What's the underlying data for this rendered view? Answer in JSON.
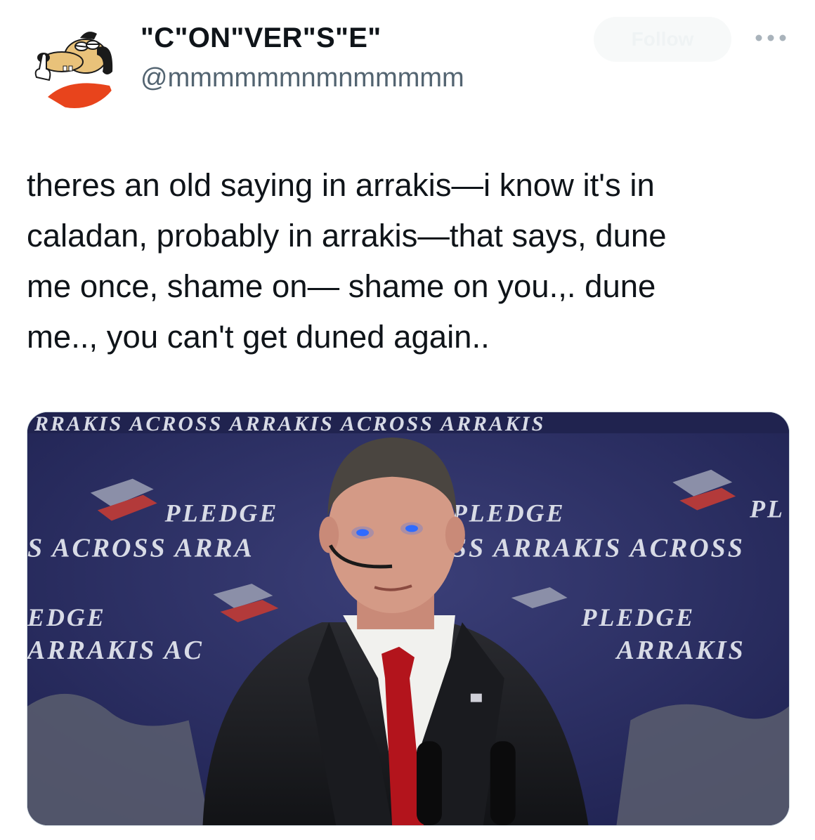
{
  "tweet": {
    "author": {
      "display_name": "\"C\"ON\"VER\"S\"E\"",
      "handle": "@mmmmmmnmnmmmmm",
      "avatar_icon": "cartoon-dog-avatar"
    },
    "follow_label": "Follow",
    "more_icon": "more-dots-icon",
    "text_lines": [
      "theres an old saying in arrakis—i know it's in",
      "caladan, probably in arrakis—that says, dune",
      "me once, shame on— shame on you.,. dune",
      "me.., you can't get duned again.."
    ],
    "media": {
      "backdrop_text": {
        "top_strip": "RRAKIS  ACROSS ARRAKIS  ACROSS ARRAKIS",
        "pledge": "PLEDGE",
        "across_arrakis_1": "S  ACROSS ARRA",
        "across_arrakis_2": "SS ARRAKIS  ACROSS",
        "edge": "EDGE",
        "arrakis_left": "ARRAKIS  AC",
        "arrakis_right": "ARRAKIS",
        "pl": "PL",
        "pledge_partial": "PLEDGE"
      }
    },
    "colors": {
      "text": "#0f1419",
      "secondary": "#536471",
      "backdrop": "#2a2e5e",
      "tie": "#b3141c",
      "eye_glow": "#2f6bff"
    }
  }
}
